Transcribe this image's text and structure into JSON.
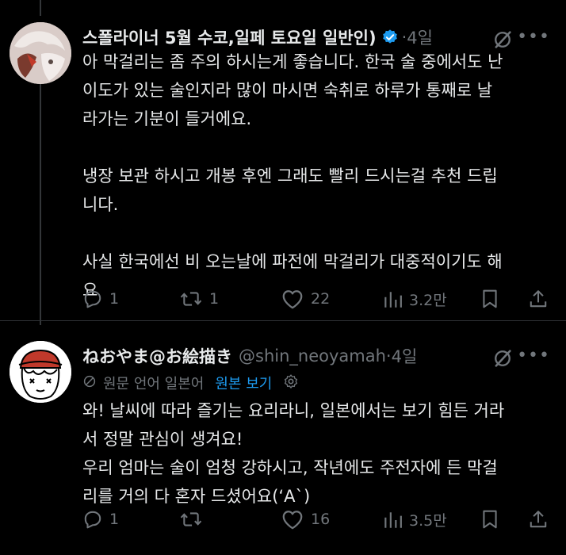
{
  "tweets": [
    {
      "name": "스폴라이너 5월 수코,일페 토요일 일반인)",
      "handle": "",
      "dot": "·",
      "time": "4일",
      "verified": true,
      "lines": [
        "아 막걸리는 좀 주의 하시는게 좋습니다. 한국 술 중에서도 난",
        "이도가 있는 술인지라 많이 마시면 숙취로 하루가 통째로 날",
        "라가는 기분이 들거에요.",
        "",
        "냉장 보관 하시고 개봉 후엔 그래도 빨리 드시는걸 추천 드립",
        "니다.",
        "",
        "사실 한국에선 비 오는날에 파전에 막걸리가 대중적이기도 해",
        "요"
      ],
      "actions": {
        "replies": "1",
        "reposts": "1",
        "likes": "22",
        "views": "3.2만"
      }
    },
    {
      "name": "ねおやま@お絵描き",
      "handle": "@shin_neoyamah",
      "dot": "·",
      "time": "4일",
      "verified": false,
      "translate": {
        "label": "원문 언어 일본어",
        "link": "원본 보기"
      },
      "lines": [
        "와! 날씨에 따라 즐기는 요리라니, 일본에서는 보기 힘든 거라",
        "서 정말 관심이 생겨요!",
        "우리 엄마는 술이 엄청 강하시고, 작년에도 주전자에 든 막걸",
        "리를 거의 다 혼자 드셨어요(‘A`)"
      ],
      "actions": {
        "replies": "1",
        "reposts": "",
        "likes": "16",
        "views": "3.5만"
      }
    }
  ],
  "colors": {
    "background": "#000000",
    "text": "#e7e9ea",
    "muted": "#71767b",
    "link": "#1d9bf0",
    "verified": "#1d9bf0"
  },
  "icons": [
    "reply-icon",
    "repost-icon",
    "like-icon",
    "views-icon",
    "bookmark-icon",
    "share-icon",
    "grok-icon",
    "more-icon",
    "verified-icon",
    "translate-icon",
    "settings-icon"
  ]
}
